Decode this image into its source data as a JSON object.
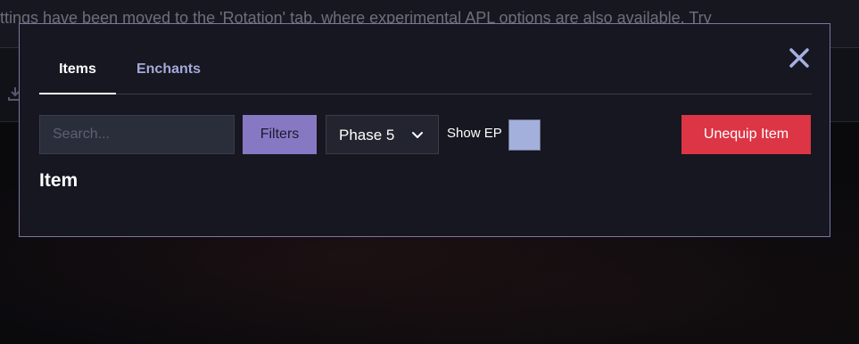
{
  "background": {
    "banner_text": "ttings have been moved to the 'Rotation' tab, where experimental APL options are also available. Try",
    "download_icon": "download-icon"
  },
  "modal": {
    "close_icon": "close-icon",
    "tabs": [
      {
        "label": "Items",
        "active": true
      },
      {
        "label": "Enchants",
        "active": false
      }
    ],
    "search": {
      "placeholder": "Search...",
      "value": ""
    },
    "filters_label": "Filters",
    "phase_select": {
      "selected": "Phase 5",
      "icon": "chevron-down-icon"
    },
    "show_ep_label": "Show EP",
    "unequip_label": "Unequip Item",
    "item_heading": "Item"
  },
  "colors": {
    "accent_purple": "#8778c4",
    "danger_red": "#dc3545",
    "modal_border": "#7b74a8",
    "checkbox_fill": "#a3b0dc",
    "tab_inactive": "#a4a9d8"
  }
}
